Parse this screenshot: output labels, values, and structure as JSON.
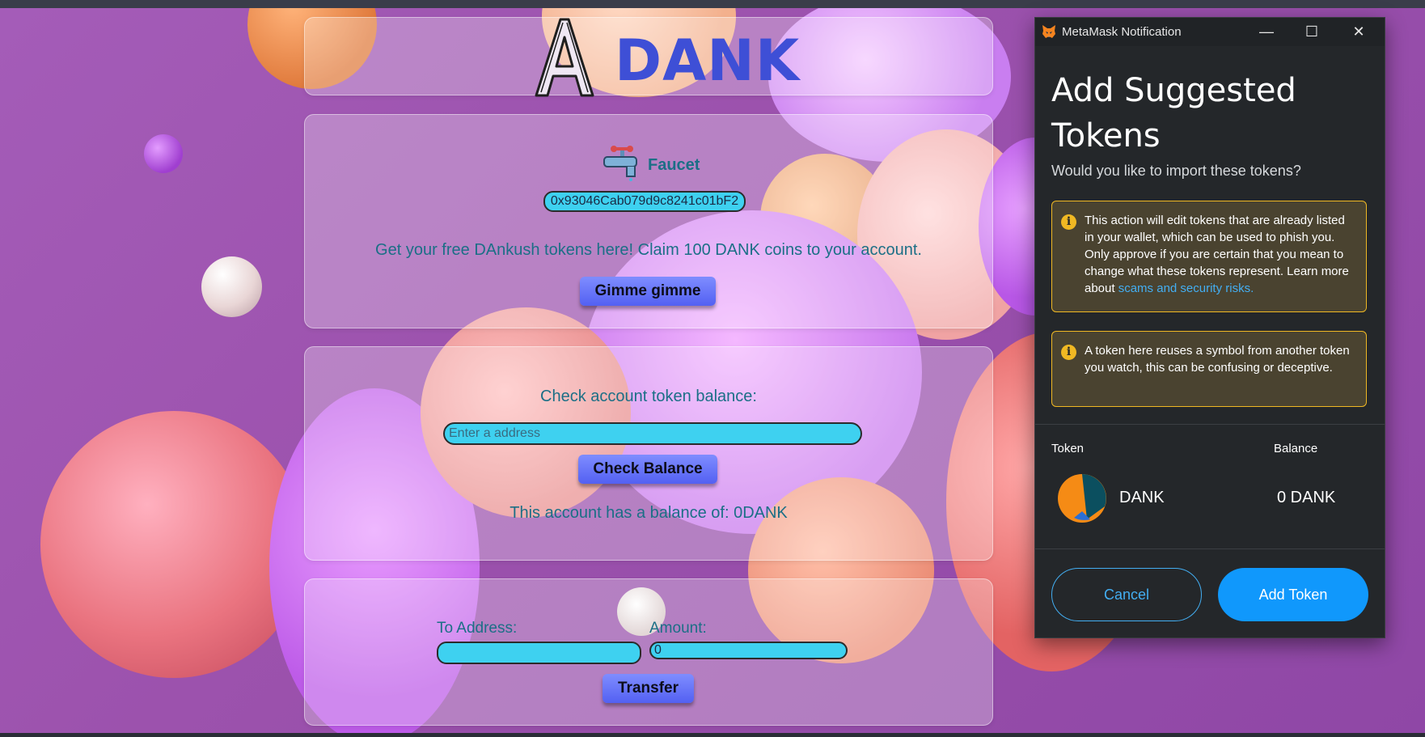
{
  "app": {
    "logo_text": "DANK"
  },
  "faucet": {
    "title": "Faucet",
    "address": "0x93046Cab079d9c8241c01bF2",
    "promo": "Get your free DAnkush tokens here! Claim 100 DANK coins to your account.",
    "button_label": "Gimme gimme"
  },
  "balance": {
    "label": "Check account token balance:",
    "input_placeholder": "Enter a address",
    "button_label": "Check Balance",
    "result_text": "This account has a balance of: 0DANK"
  },
  "transfer": {
    "to_label": "To Address:",
    "amount_label": "Amount:",
    "amount_value": "0",
    "button_label": "Transfer"
  },
  "metamask": {
    "window_title": "MetaMask Notification",
    "controls": {
      "minimize": "—",
      "maximize": "☐",
      "close": "✕"
    },
    "heading": "Add Suggested Tokens",
    "subtitle": "Would you like to import these tokens?",
    "warning1_text": "This action will edit tokens that are already listed in your wallet, which can be used to phish you. Only approve if you are certain that you mean to change what these tokens represent. Learn more about ",
    "warning1_link": "scams and security risks.",
    "warning2_text": "A token here reuses a symbol from another token you watch, this can be confusing or deceptive.",
    "warning_icon": "i",
    "col_token": "Token",
    "col_balance": "Balance",
    "token_name": "DANK",
    "token_balance": "0 DANK",
    "cancel_label": "Cancel",
    "add_label": "Add Token"
  },
  "colors": {
    "accent_blue": "#3e4fd6",
    "teal_text": "#1b6f86",
    "input_cyan": "#3ed1f0",
    "metamask_blue": "#1098fc",
    "warning_yellow": "#f0b823"
  }
}
